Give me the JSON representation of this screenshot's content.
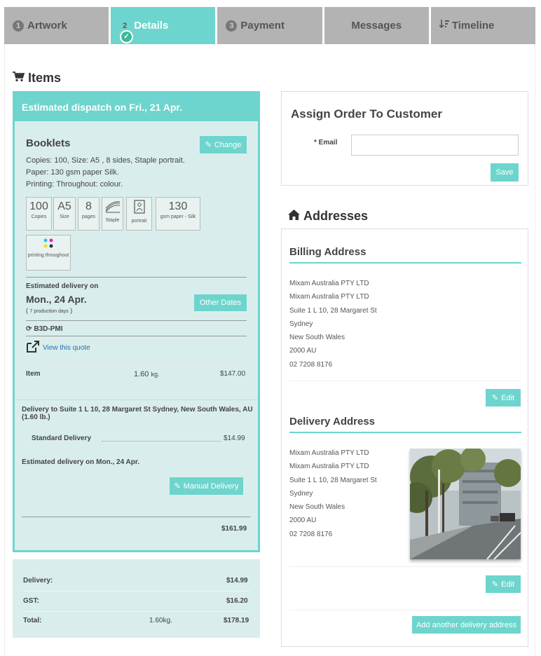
{
  "tabs": [
    {
      "num": "1",
      "label": "Artwork"
    },
    {
      "num": "2",
      "label": "Details"
    },
    {
      "num": "3",
      "label": "Payment"
    },
    {
      "label": "Messages"
    },
    {
      "label": "Timeline"
    }
  ],
  "items_heading": "Items",
  "order": {
    "dispatch": "Estimated dispatch on Fri., 21 Apr.",
    "product": "Booklets",
    "change_label": "Change",
    "line1": "Copies: 100, Size: A5 , 8 sides, Staple portrait.",
    "line2": "Paper: 130 gsm paper Silk.",
    "line3": "Printing: Throughout: colour.",
    "specs": [
      {
        "value": "100",
        "label": "Copies"
      },
      {
        "value": "A5",
        "label": "Size"
      },
      {
        "value": "8",
        "label": "pages"
      },
      {
        "value": "",
        "label": "Staple"
      },
      {
        "value": "",
        "label": "portrait"
      },
      {
        "value": "130",
        "label": "gsm paper - Silk"
      }
    ],
    "printing_label": "printing throughout",
    "est_delivery_label": "Estimated delivery on",
    "est_delivery_date": "Mon., 24 Apr.",
    "production_days_prefix": "(",
    "production_days": "7 production days",
    "production_days_suffix": ")",
    "other_dates_label": "Other Dates",
    "code": "B3D-PMI",
    "view_quote": "View this quote",
    "item_label": "Item",
    "item_weight": "1.60",
    "item_weight_unit": "kg.",
    "item_price": "$147.00",
    "delivery_to": "Delivery to Suite 1 L 10, 28 Margaret St Sydney, New South Wales, AU (1.60 lb.)",
    "standard_delivery": "Standard Delivery",
    "standard_price": "$14.99",
    "est_delivery_text": "Estimated delivery on Mon., 24 Apr.",
    "manual_delivery": "Manual Delivery",
    "subtotal": "$161.99"
  },
  "totals": {
    "delivery_label": "Delivery:",
    "delivery": "$14.99",
    "gst_label": "GST:",
    "gst": "$16.20",
    "total_label": "Total:",
    "weight": "1.60",
    "weight_unit": "kg.",
    "total": "$178.19"
  },
  "assign": {
    "title": "Assign Order To Customer",
    "email_label": "* Email",
    "email_value": "",
    "save_label": "Save"
  },
  "addresses_heading": "Addresses",
  "billing": {
    "title": "Billing Address",
    "lines": [
      "Mixam Australia PTY LTD",
      "Mixam Australia PTY LTD",
      "Suite 1 L 10, 28 Margaret St",
      "Sydney",
      "New South Wales",
      "2000 AU",
      "02 7208 8176"
    ],
    "edit_label": "Edit"
  },
  "delivery": {
    "title": "Delivery Address",
    "lines": [
      "Mixam Australia PTY LTD",
      "Mixam Australia PTY LTD",
      "Suite 1 L 10, 28 Margaret St",
      "Sydney",
      "New South Wales",
      "2000 AU",
      "02 7208 8176"
    ],
    "edit_label": "Edit",
    "add_label": "Add another delivery address"
  },
  "colors": {
    "accent": "#6dd5cd",
    "panel": "#d9eeec",
    "tab_gray": "#b3b3b3",
    "link": "#1f6fb2"
  }
}
